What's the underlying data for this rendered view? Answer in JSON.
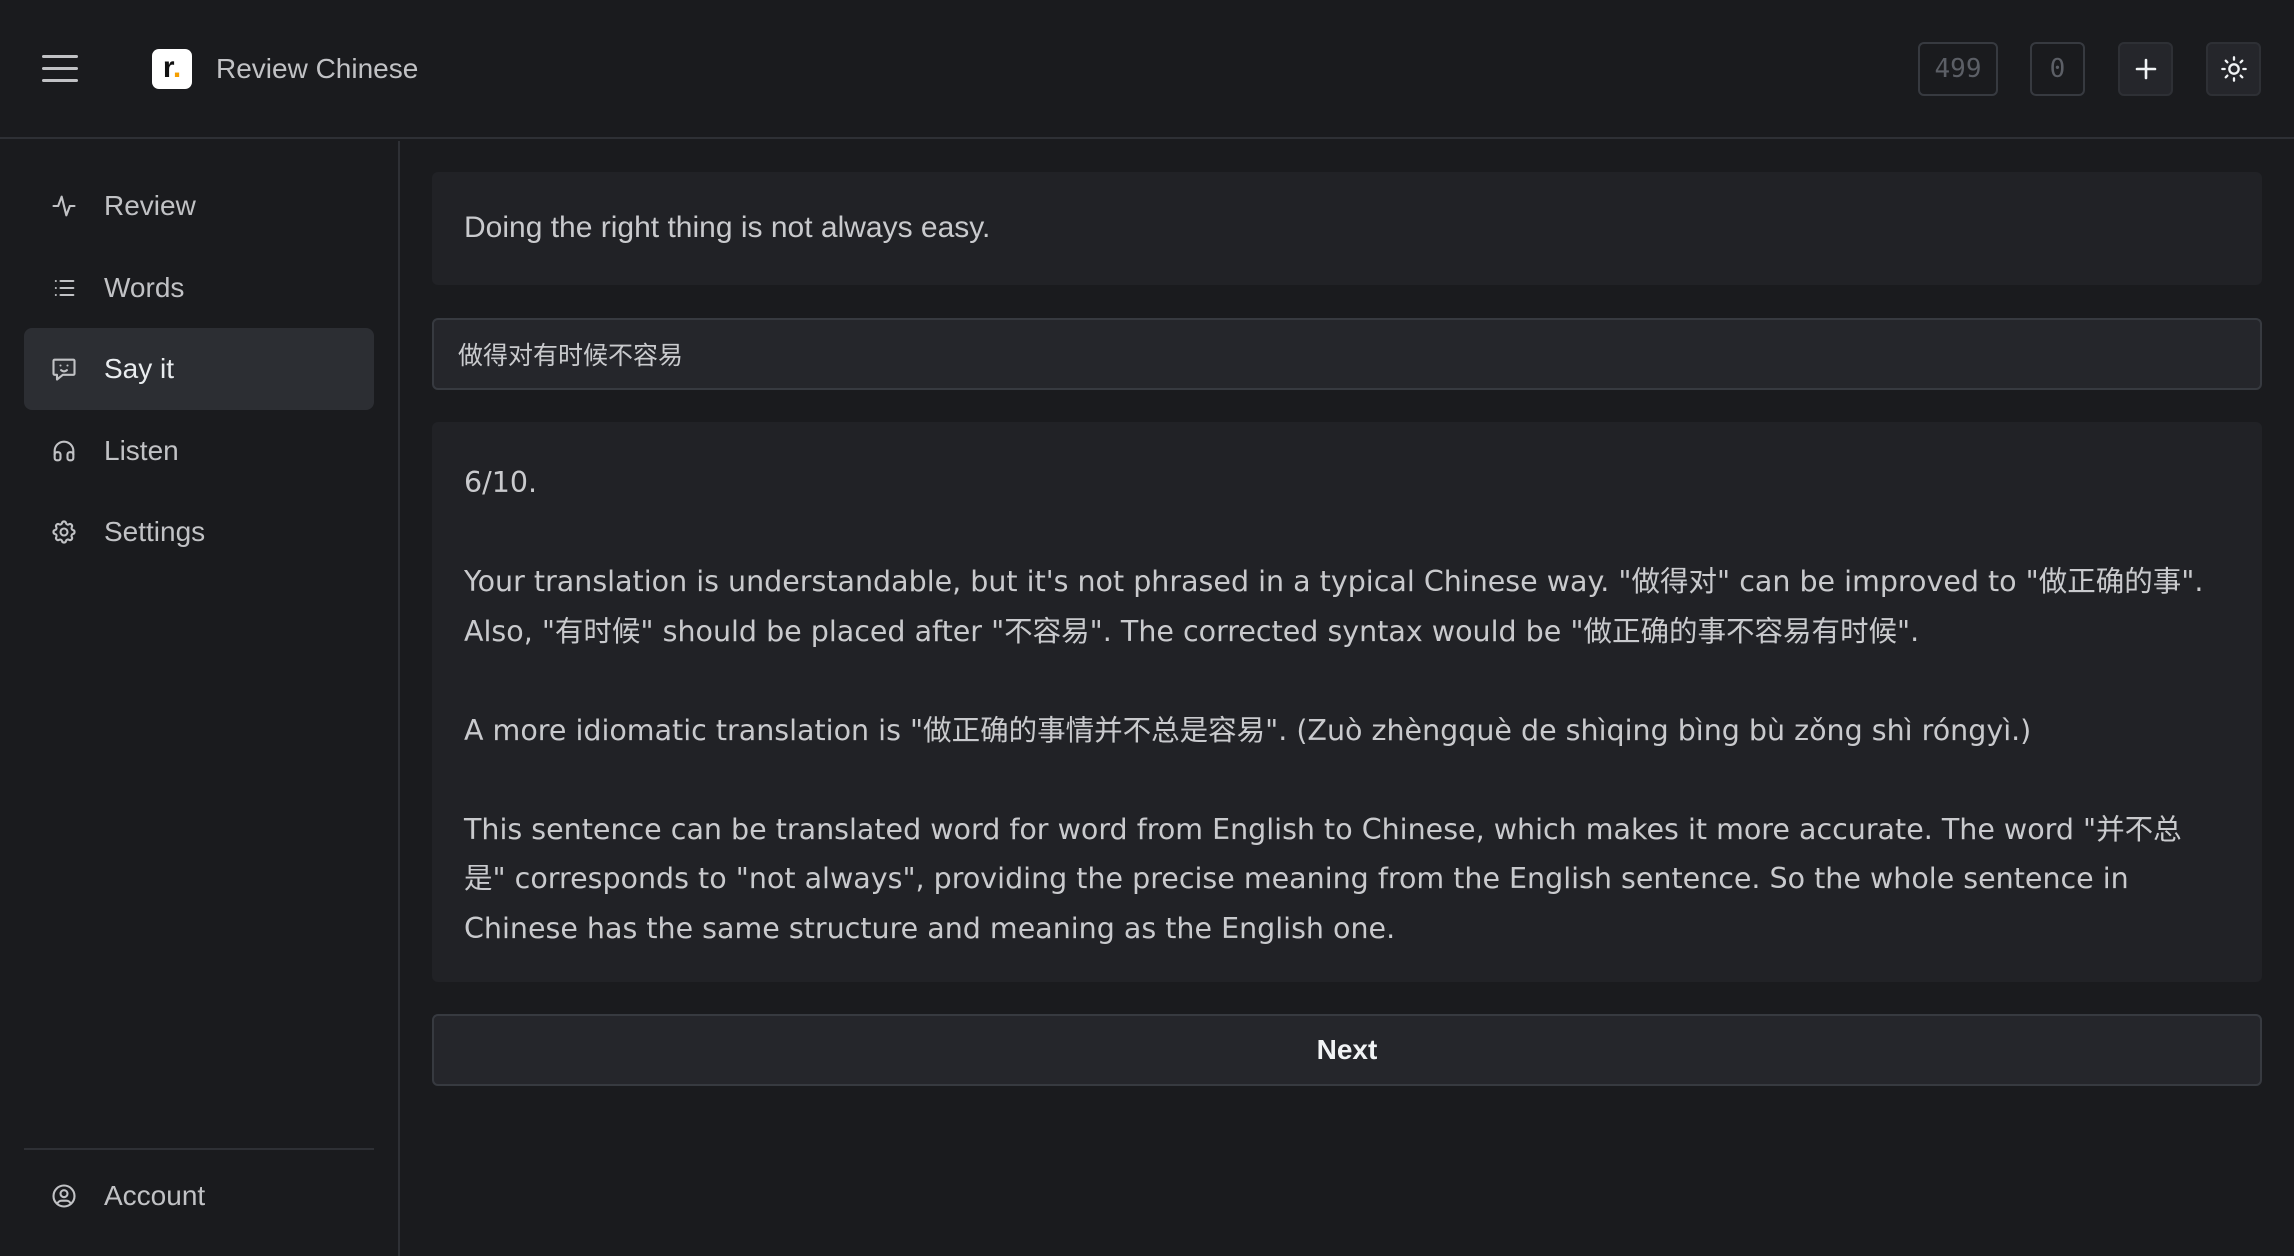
{
  "header": {
    "app_title": "Review Chinese",
    "logo_letter": "r",
    "logo_dot": ".",
    "counter_a": "499",
    "counter_b": "0",
    "icons": [
      "menu-icon",
      "plus-icon",
      "sun-icon"
    ]
  },
  "sidebar": {
    "items": [
      {
        "label": "Review",
        "icon": "activity-icon",
        "active": false
      },
      {
        "label": "Words",
        "icon": "list-icon",
        "active": false
      },
      {
        "label": "Say it",
        "icon": "message-smile-icon",
        "active": true
      },
      {
        "label": "Listen",
        "icon": "headphones-icon",
        "active": false
      },
      {
        "label": "Settings",
        "icon": "gear-icon",
        "active": false
      }
    ],
    "account": {
      "label": "Account",
      "icon": "user-circle-icon"
    }
  },
  "main": {
    "prompt": "Doing the right thing is not always easy.",
    "answer_value": "做得对有时候不容易",
    "feedback": {
      "score": "6/10.",
      "lines": [
        "Your translation is understandable, but it's not phrased in a typical Chinese way. \"做得对\" can be improved to \"做正确的事\".",
        "Also, \"有时候\" should be placed after \"不容易\". The corrected syntax would be \"做正确的事不容易有时候\".",
        "A more idiomatic translation is \"做正确的事情并不总是容易\". (Zuò zhèngquè de shìqing bìng bù zǒng shì róngyì.)",
        "This sentence can be translated word for word from English to Chinese, which makes it more accurate. The word \"并不总",
        "是\" corresponds to \"not always\", providing the precise meaning from the English sentence. So the whole sentence in",
        "Chinese has the same structure and meaning as the English one."
      ]
    },
    "next_label": "Next"
  },
  "colors": {
    "background": "#1a1b1e",
    "card": "#212226",
    "active_nav": "#2c2e33",
    "border": "#373a40",
    "logo_accent": "#f59f00"
  }
}
